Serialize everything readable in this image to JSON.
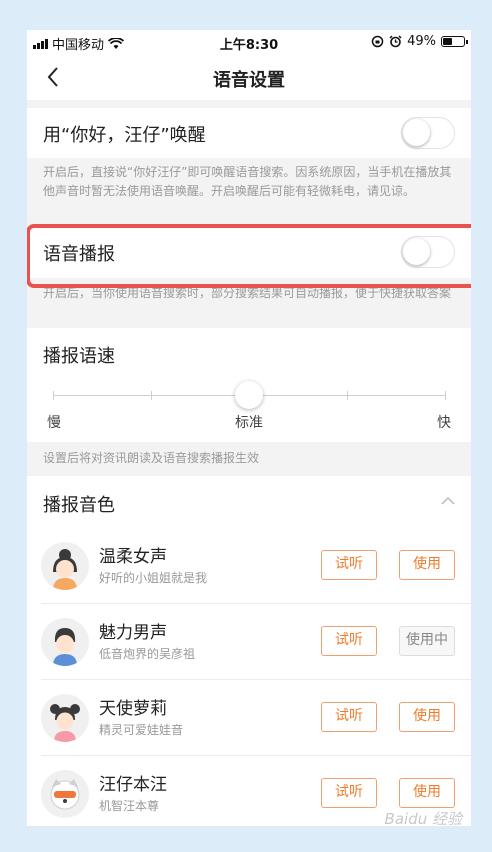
{
  "status_bar": {
    "carrier": "中国移动",
    "time": "上午8:30",
    "battery": "49%",
    "battery_level": 0.49
  },
  "nav": {
    "title": "语音设置"
  },
  "wake_setting": {
    "label": "用“你好，汪仔”唤醒",
    "enabled": false,
    "hint": "开启后，直接说“你好汪仔”即可唤醒语音搜索。因系统原因，当手机在播放其他声音时暂无法使用语音唤醒。开启唤醒后可能有轻微耗电，请见谅。"
  },
  "broadcast_setting": {
    "label": "语音播报",
    "enabled": false,
    "hint": "开启后，当你使用语音搜索时，部分搜索结果可自动播报，便于快捷获取答案"
  },
  "speed": {
    "title": "播报语速",
    "labels": [
      "慢",
      "标准",
      "快"
    ],
    "steps": 5,
    "selected_index": 2,
    "hint": "设置后将对资讯朗读及语音搜索播报生效"
  },
  "voices": {
    "title": "播报音色",
    "try_label": "试听",
    "items": [
      {
        "name": "温柔女声",
        "desc": "好听的小姐姐就是我",
        "action": "使用"
      },
      {
        "name": "魅力男声",
        "desc": "低音炮界的吴彦祖",
        "action": "使用中"
      },
      {
        "name": "天使萝莉",
        "desc": "精灵可爱娃娃音",
        "action": "使用"
      },
      {
        "name": "汪仔本汪",
        "desc": "机智汪本尊",
        "action": "使用"
      }
    ]
  },
  "watermark": "Baidu 经验",
  "colors": {
    "accent": "#f07c2c",
    "highlight": "#e8524f",
    "background": "#dcecf8"
  }
}
